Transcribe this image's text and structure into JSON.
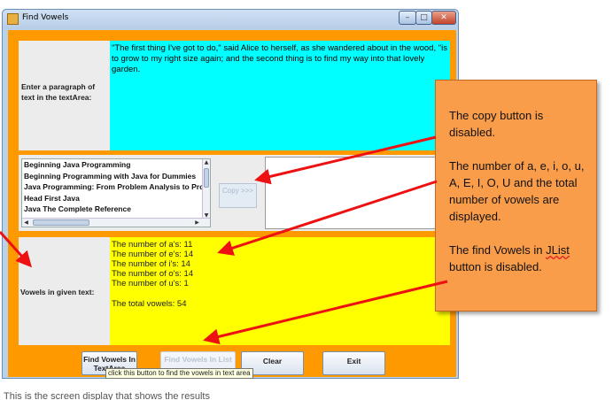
{
  "window": {
    "title": "Find Vowels",
    "minimize_glyph": "–",
    "maximize_glyph": "□",
    "close_glyph": "✕"
  },
  "input_panel": {
    "label": "Enter a paragraph of text in the textArea:",
    "text": "\"The first thing I've got to do,\" said Alice to herself, as she wandered about in the wood, \"is to grow to my right size again; and the second thing is to find my way into that lovely garden."
  },
  "book_list": {
    "items": [
      "Beginning Java Programming",
      "Beginning Programming with Java for Dummies",
      "Java Programming: From Problem Analysis to Program Design",
      "Head First Java",
      "Java The Complete Reference"
    ],
    "copy_button": "Copy >>>",
    "copy_enabled": false
  },
  "results_panel": {
    "label": "Vowels in given text:",
    "counts": [
      "The number of a's: 11",
      "The number of e's: 14",
      "The number of i's: 14",
      "The number of o's: 14",
      "The number of u's: 1"
    ],
    "total": "The total vowels: 54"
  },
  "buttons": {
    "find_in_text": "Find Vowels In TextArea",
    "find_in_list": "Find Vowels In List",
    "find_in_list_enabled": false,
    "clear": "Clear",
    "exit": "Exit"
  },
  "tooltip": "click this button to find the vowels in text area",
  "callout": {
    "line1": "The copy button is disabled.",
    "line2": "The number of a, e, i, o, u, A, E, I, O, U and the total number of vowels are displayed.",
    "line3_before": "The find Vowels in ",
    "line3_underlined": "JList",
    "line3_after": " button is disabled.",
    "fill_color": "#fa9d4b"
  },
  "colors": {
    "frame_orange": "#ff9900",
    "text_area_cyan": "#00ffff",
    "results_yellow": "#ffff00",
    "arrow_red": "#ee1111"
  },
  "caption": "This is the screen display that shows the results"
}
